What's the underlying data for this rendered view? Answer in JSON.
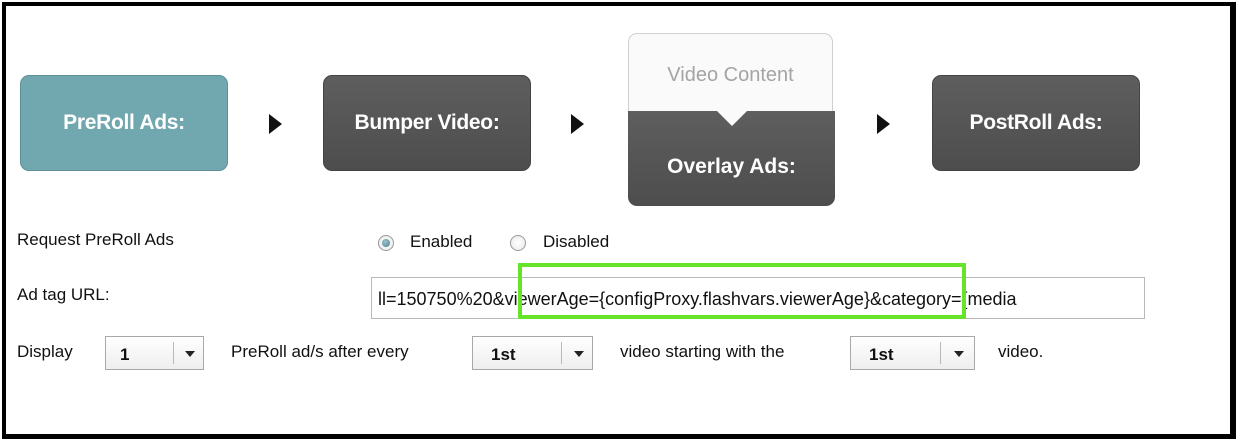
{
  "flow": {
    "preroll_label": "PreRoll Ads:",
    "bumper_label": "Bumper Video:",
    "video_content_label": "Video Content",
    "overlay_label": "Overlay Ads:",
    "postroll_label": "PostRoll Ads:"
  },
  "request": {
    "label": "Request PreRoll Ads",
    "enabled_label": "Enabled",
    "disabled_label": "Disabled",
    "selected": "Enabled"
  },
  "adtag": {
    "label": "Ad tag URL:",
    "value": "ll=150750%20&viewerAge={configProxy.flashvars.viewerAge}&category={media"
  },
  "display": {
    "label_display": "Display",
    "count_value": "1",
    "label_after": "PreRoll ad/s after every",
    "every_value": "1st",
    "label_starting": "video starting with the",
    "start_value": "1st",
    "label_video": "video."
  },
  "colors": {
    "preroll_active": "#71a7af",
    "stage_dark": "#555555",
    "highlight": "#66e42a"
  }
}
